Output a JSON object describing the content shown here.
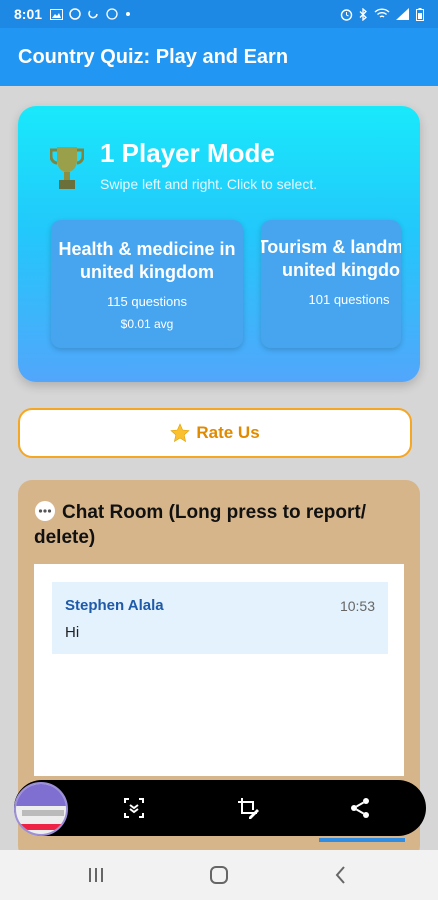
{
  "status_bar": {
    "time": "8:01",
    "left_icons": [
      "image-icon",
      "blocked-icon",
      "hotspot-icon",
      "data-saver-icon",
      "dot-icon"
    ],
    "right_icons": [
      "alarm-icon",
      "bluetooth-icon",
      "wifi-icon",
      "signal-icon",
      "battery-icon"
    ]
  },
  "app_bar": {
    "title": "Country Quiz: Play and Earn"
  },
  "player_mode": {
    "title": "1 Player Mode",
    "subtitle": "Swipe left and right. Click to select.",
    "icon": "trophy-icon",
    "quizzes": [
      {
        "title": "Health & medicine in united kingdom",
        "questions": "115 questions",
        "price": "$0.01 avg"
      },
      {
        "title": "Tourism & landmarks united kingdom",
        "questions": "101 questions"
      }
    ]
  },
  "rate_us": {
    "label": "Rate Us",
    "icon": "star-icon"
  },
  "chat": {
    "title": "Chat Room (Long press to report/ delete)",
    "icon": "chat-bubble-icon",
    "messages": [
      {
        "author": "Stephen Alala",
        "time": "10:53",
        "text": "Hi"
      }
    ]
  },
  "screenshot_toolbar": {
    "icons": [
      "scroll-capture-icon",
      "crop-edit-icon",
      "share-icon"
    ]
  },
  "nav_bar": {
    "icons": [
      "recent-apps-icon",
      "home-icon",
      "back-icon"
    ]
  },
  "colors": {
    "app_bar": "#2196f3",
    "status_bar": "#1e88e5",
    "card_gradient_top": "#19e9fb",
    "card_gradient_bottom": "#52a6fb",
    "rate_border": "#f5a623",
    "chat_bg": "#d7b58b",
    "message_bg": "#e3f2fd"
  }
}
